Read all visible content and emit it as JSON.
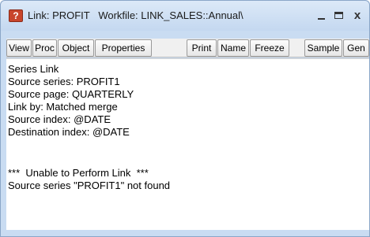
{
  "window": {
    "title": "Link: PROFIT   Workfile: LINK_SALES::Annual\\",
    "icon": "question-icon"
  },
  "toolbar": {
    "buttons": [
      "View",
      "Proc",
      "Object",
      "Properties",
      "Print",
      "Name",
      "Freeze",
      "Sample",
      "Gen"
    ]
  },
  "content": {
    "lines": [
      "Series Link",
      "Source series: PROFIT1",
      "Source page: QUARTERLY",
      "Link by: Matched merge",
      "Source index: @DATE",
      "Destination index: @DATE",
      "",
      "***  Unable to Perform Link  ***",
      "Source series \"PROFIT1\" not found"
    ]
  }
}
